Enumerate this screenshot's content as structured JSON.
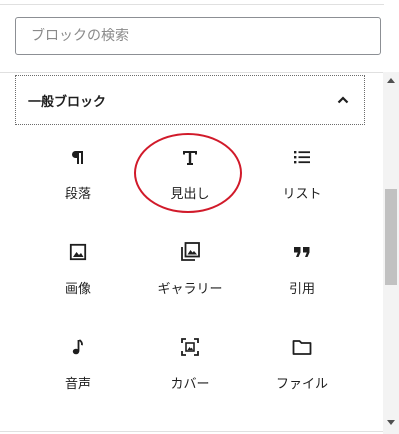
{
  "search": {
    "placeholder": "ブロックの検索",
    "value": ""
  },
  "panel": {
    "title": "一般ブロック",
    "toggle_icon": "chevron-up-icon",
    "expanded": true
  },
  "blocks": [
    {
      "label": "段落",
      "icon": "paragraph-icon"
    },
    {
      "label": "見出し",
      "icon": "heading-icon",
      "highlighted": true
    },
    {
      "label": "リスト",
      "icon": "list-icon"
    },
    {
      "label": "画像",
      "icon": "image-icon"
    },
    {
      "label": "ギャラリー",
      "icon": "gallery-icon"
    },
    {
      "label": "引用",
      "icon": "quote-icon"
    },
    {
      "label": "音声",
      "icon": "audio-icon"
    },
    {
      "label": "カバー",
      "icon": "cover-icon"
    },
    {
      "label": "ファイル",
      "icon": "folder-icon"
    }
  ],
  "colors": {
    "highlight_circle": "#d11a2a",
    "text": "#1e1e1e",
    "border": "#8c8f94"
  }
}
